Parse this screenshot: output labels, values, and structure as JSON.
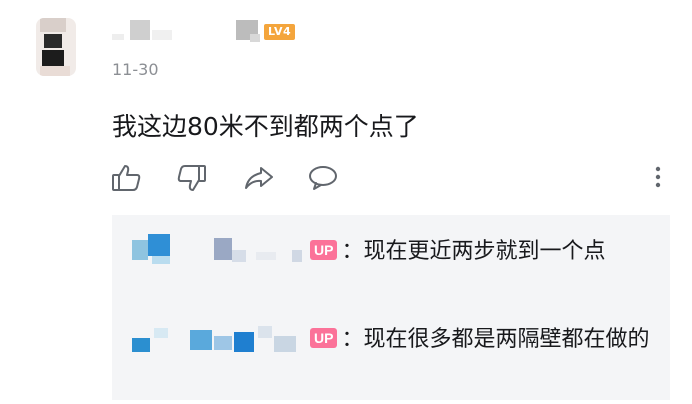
{
  "comment": {
    "level_badge": "LV4",
    "date": "11-30",
    "text": "我这边80米不到都两个点了",
    "actions": [
      "like-icon",
      "dislike-icon",
      "share-icon",
      "reply-icon",
      "more-icon"
    ]
  },
  "replies": [
    {
      "badge": "UP",
      "text": "：现在更近两步就到一个点"
    },
    {
      "badge": "UP",
      "text": "：现在很多都是两隔壁都在做的"
    }
  ],
  "colors": {
    "level_badge": "#f4a53c",
    "up_badge": "#fb7299",
    "reply_bg": "#f4f5f7",
    "muted_text": "#8c8f94"
  }
}
